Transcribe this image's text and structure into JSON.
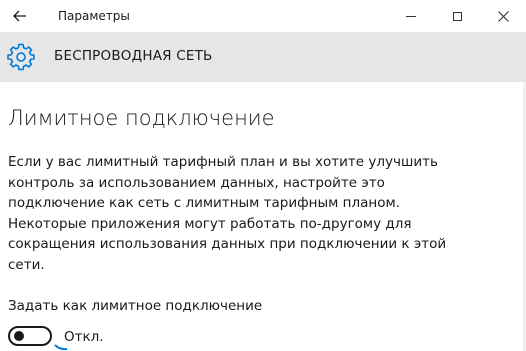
{
  "window": {
    "title": "Параметры",
    "controls": {
      "minimize": "minimize",
      "maximize": "maximize",
      "close": "close"
    }
  },
  "header": {
    "icon": "gear-icon",
    "title": "БЕСПРОВОДНАЯ СЕТЬ",
    "background": "#e6e6e6"
  },
  "main": {
    "title": "Лимитное подключение",
    "description_lines": [
      "Если у вас лимитный тарифный план и вы хотите улучшить",
      "контроль за использованием данных, настройте это",
      "подключение как сеть с лимитным тарифным планом.",
      "Некоторые приложения могут работать по-другому для",
      "сокращения использования данных при подключении к этой",
      "сети."
    ],
    "toggle": {
      "label": "Задать как лимитное подключение",
      "state_text": "Откл.",
      "on": false
    }
  },
  "colors": {
    "accent": "#0078d7",
    "text": "#1a1a1a",
    "header_band": "#e6e6e6"
  }
}
